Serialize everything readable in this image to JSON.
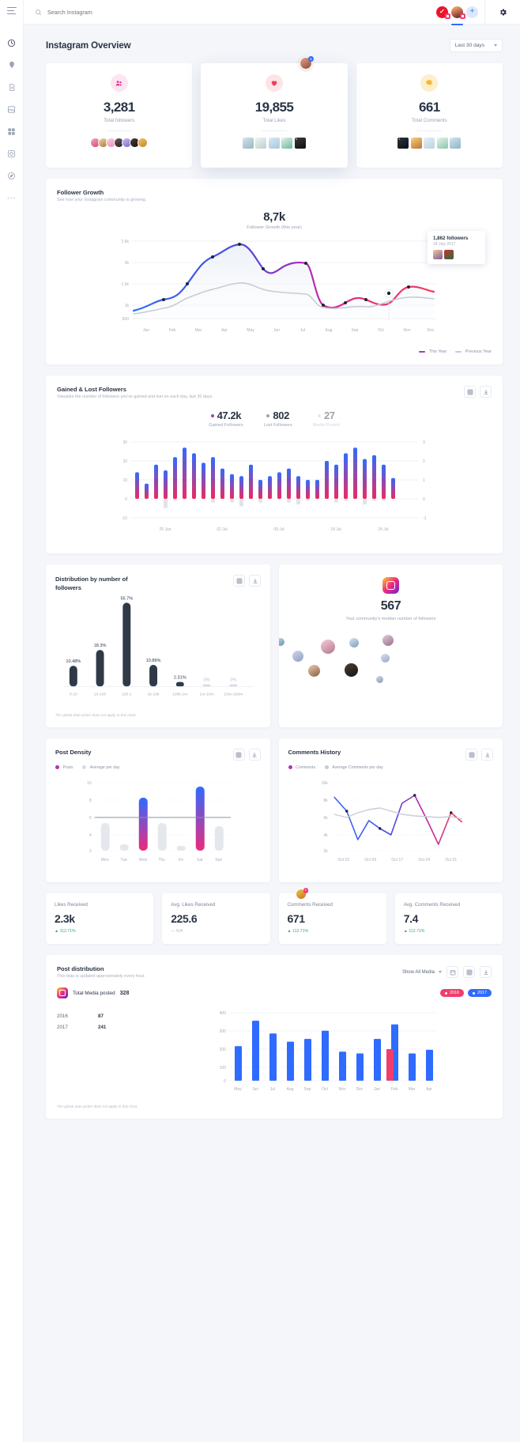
{
  "topbar": {
    "search_placeholder": "Search Instagram",
    "search_icon": "search-icon",
    "accounts": [
      "nike-account-avatar",
      "user-account-avatar"
    ],
    "add_label": "+",
    "settings_icon": "gear-icon"
  },
  "sidebar": {
    "menu_icon": "hamburger-icon",
    "items": [
      {
        "name": "analytics-icon"
      },
      {
        "name": "location-pin-icon"
      },
      {
        "name": "document-icon"
      },
      {
        "name": "image-icon"
      },
      {
        "name": "grid-icon"
      },
      {
        "name": "camera-icon"
      },
      {
        "name": "compass-icon"
      }
    ],
    "more_label": "..."
  },
  "page": {
    "title": "Instagram Overview",
    "range_value": "Last 30 days"
  },
  "stats": [
    {
      "value": "3,281",
      "label": "Total followers",
      "icon": "people-icon",
      "bg": "#fae5f1",
      "fg": "#ea2a8b"
    },
    {
      "value": "19,855",
      "label": "Total Likes",
      "icon": "heart-icon",
      "bg": "#fde4e6",
      "fg": "#ef3d5a"
    },
    {
      "value": "661",
      "label": "Total Comments",
      "icon": "comment-icon",
      "bg": "#fdeecd",
      "fg": "#f5b731"
    }
  ],
  "follower_growth": {
    "title": "Follower Growth",
    "subtitle": "See how your Instagram community is growing.",
    "headline_value": "8,7k",
    "headline_label": "Follower Growth (this year)",
    "tooltip": {
      "value": "1,862 followers",
      "date": "18 July 2017"
    },
    "legend": [
      {
        "label": "This Year",
        "color": "#ee2a7b"
      },
      {
        "label": "Previous Year",
        "color": "#c7ccd6"
      }
    ]
  },
  "gained_lost": {
    "title": "Gained & Lost Followers",
    "subtitle": "Visualize the number of followers you've gained and lost on each day, last 30 days.",
    "metrics": [
      {
        "value": "47.2k",
        "label": "Gained Followers",
        "color": "#ee2a7b",
        "muted": false
      },
      {
        "value": "802",
        "label": "Lost Followers",
        "color": "#9aa3b4",
        "muted": false
      },
      {
        "value": "27",
        "label": "Media Posted",
        "color": "#d7dbe3",
        "muted": true
      }
    ],
    "actions": [
      "table-view-icon",
      "download-icon"
    ]
  },
  "distribution": {
    "title": "Distribution by number of followers",
    "note": "The global date picker does not apply to this chart.",
    "actions": [
      "table-view-icon",
      "download-icon"
    ],
    "median_value": "567",
    "median_label": "Your community's median number of followers"
  },
  "post_density": {
    "title": "Post Density",
    "legend": [
      {
        "label": "Posts",
        "color": "#ee2a7b"
      },
      {
        "label": "Average per day",
        "color": "#d7dbe3"
      }
    ],
    "actions": [
      "table-view-icon",
      "download-icon"
    ]
  },
  "comments_history": {
    "title": "Comments History",
    "legend": [
      {
        "label": "Comments",
        "color": "#ee2a7b"
      },
      {
        "label": "Average Comments per day",
        "color": "#c7ccd6"
      }
    ],
    "actions": [
      "table-view-icon",
      "download-icon"
    ]
  },
  "metric_cards": [
    {
      "label": "Likes Received",
      "value": "2.3k",
      "delta": "▲ 112.71%",
      "na": false
    },
    {
      "label": "Avg. Likes Received",
      "value": "225.6",
      "delta": "— N/A",
      "na": true
    },
    {
      "label": "Comments Received",
      "value": "671",
      "delta": "▲ 112.71%",
      "na": false
    },
    {
      "label": "Avg. Comments Received",
      "value": "7.4",
      "delta": "▲ 112.71%",
      "na": false
    }
  ],
  "post_distribution": {
    "title": "Post distribution",
    "subtitle": "This data is updated approximately every hour.",
    "filter_label": "Show All Media",
    "actions": [
      "calendar-icon",
      "table-view-icon",
      "download-icon"
    ],
    "total_label": "Total Media posted",
    "total_value": "328",
    "years": [
      {
        "year": "2016",
        "count": "87",
        "color": "#ef3d6e"
      },
      {
        "year": "2017",
        "count": "241",
        "color": "#2f6bff"
      }
    ],
    "note": "The global date picker does not apply to this chart."
  },
  "chart_data": [
    {
      "type": "line",
      "name": "follower-growth",
      "title": "Follower Growth",
      "x": [
        "Jan",
        "Feb",
        "Mar",
        "Apr",
        "May",
        "Jun",
        "Jul",
        "Aug",
        "Sep",
        "Oct",
        "Nov",
        "Dec"
      ],
      "ylim": [
        500,
        2500
      ],
      "yticks": [
        "500",
        "1k",
        "1.5k",
        "2k",
        "2.5k"
      ],
      "series": [
        {
          "name": "This Year",
          "values": [
            900,
            1100,
            1500,
            2050,
            2400,
            1780,
            1950,
            1010,
            1170,
            1000,
            1240,
            1500,
            1460
          ]
        },
        {
          "name": "Previous Year",
          "values": [
            880,
            950,
            1130,
            1300,
            1520,
            1380,
            1350,
            980,
            960,
            980,
            1080,
            1180,
            1200
          ]
        }
      ],
      "annotation": {
        "label": "1,862 followers",
        "date": "18 July 2017"
      }
    },
    {
      "type": "bar",
      "name": "gained-lost-followers",
      "xticks": [
        "25 Jun",
        "02 Jul",
        "09 Jul",
        "18 Jul",
        "24 Jul"
      ],
      "ylim_left": [
        -10,
        30
      ],
      "yticks_left": [
        "-10",
        "0",
        "10",
        "20",
        "30"
      ],
      "ylim_right": [
        -1,
        3
      ],
      "yticks_right": [
        "-1",
        "0",
        "1",
        "2",
        "3"
      ],
      "gained": [
        14,
        8,
        18,
        15,
        22,
        27,
        24,
        19,
        22,
        16,
        13,
        12,
        18,
        10,
        12,
        14,
        16,
        12,
        10,
        10,
        20,
        18,
        24,
        27,
        21,
        23,
        18,
        11
      ],
      "lost": [
        0,
        0,
        0,
        -5,
        -1,
        0,
        0,
        0,
        -2,
        0,
        -2,
        -4,
        0,
        -2,
        0,
        0,
        -2,
        -3,
        -1,
        0,
        0,
        -2,
        -1,
        0,
        -3,
        -1,
        -1,
        0
      ]
    },
    {
      "type": "bar",
      "name": "distribution-by-followers",
      "categories": [
        "0-10",
        "10-100",
        "100-1",
        "1k-10k",
        "100k-1m",
        "1m-10m",
        "10m-100m"
      ],
      "values": [
        10.48,
        18.3,
        55.7,
        10.89,
        2.31,
        0,
        0
      ],
      "labels": [
        "10.48%",
        "18.3%",
        "55.7%",
        "10.89%",
        "2.31%",
        "0%",
        "0%"
      ],
      "ylabel": "%"
    },
    {
      "type": "bar",
      "name": "post-density",
      "categories": [
        "Mon",
        "Tue",
        "Wed",
        "Thu",
        "Fri",
        "Sat",
        "Sun"
      ],
      "yticks": [
        "2",
        "4",
        "6",
        "8",
        "10"
      ],
      "ylim": [
        2,
        10
      ],
      "series": [
        {
          "name": "Posts",
          "values": [
            0,
            0,
            8.3,
            0,
            0,
            9.6,
            0
          ]
        },
        {
          "name": "Average per day",
          "values": [
            5.6,
            3.2,
            0,
            5.6,
            2.4,
            0,
            5.1
          ]
        }
      ],
      "average_line": 6
    },
    {
      "type": "line",
      "name": "comments-history",
      "xticks": [
        "Oct 02",
        "Oct 09",
        "Oct 17",
        "Oct 24",
        "Oct 31"
      ],
      "yticks": [
        "2k",
        "4k",
        "6k",
        "8k",
        "10k"
      ],
      "ylim": [
        2000,
        10000
      ],
      "series": [
        {
          "name": "Comments",
          "values": [
            8600,
            6900,
            4400,
            6000,
            5000,
            8300,
            8900,
            5500,
            2900,
            5600,
            8200,
            6900
          ]
        },
        {
          "name": "Average Comments per day",
          "values": [
            6600,
            6200,
            6800,
            7100,
            7200,
            6900,
            6600,
            6500,
            6400,
            6300,
            6400,
            6200
          ]
        }
      ]
    },
    {
      "type": "bar",
      "name": "post-distribution-by-month",
      "categories": [
        "May",
        "Jun",
        "Jul",
        "Aug",
        "Sep",
        "Oct",
        "Nov",
        "Dec",
        "Jan",
        "Feb",
        "Mar",
        "Apr"
      ],
      "yticks": [
        "0",
        "100",
        "200",
        "300",
        "400"
      ],
      "ylim": [
        0,
        400
      ],
      "series": [
        {
          "name": "2016",
          "values": [
            0,
            0,
            0,
            0,
            0,
            0,
            0,
            0,
            0,
            200,
            0,
            0
          ],
          "color": "#ef3d6e"
        },
        {
          "name": "2017",
          "values": [
            190,
            330,
            260,
            215,
            230,
            275,
            160,
            150,
            230,
            310,
            150,
            170
          ],
          "color": "#2f6bff"
        }
      ]
    }
  ]
}
